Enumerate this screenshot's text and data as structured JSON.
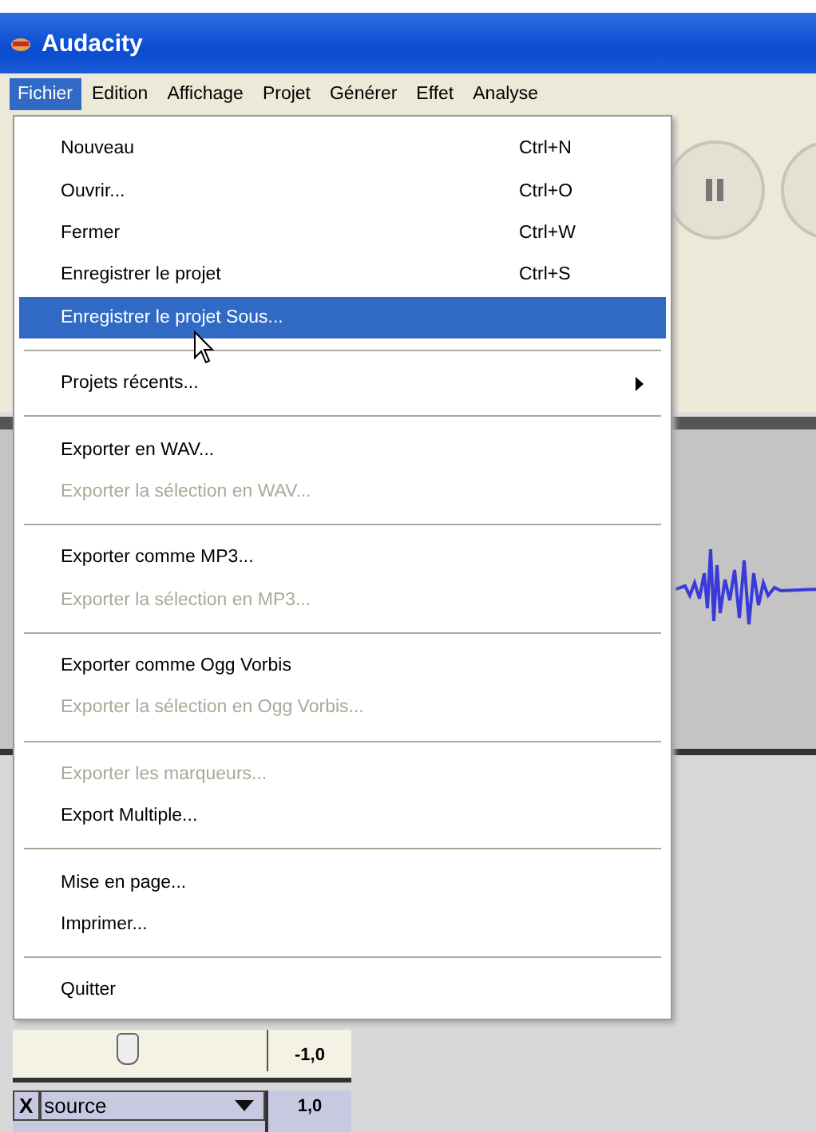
{
  "window": {
    "title": "Audacity"
  },
  "menubar": [
    {
      "label": "Fichier",
      "selected": true
    },
    {
      "label": "Edition",
      "selected": false
    },
    {
      "label": "Affichage",
      "selected": false
    },
    {
      "label": "Projet",
      "selected": false
    },
    {
      "label": "Générer",
      "selected": false
    },
    {
      "label": "Effet",
      "selected": false
    },
    {
      "label": "Analyse",
      "selected": false
    }
  ],
  "menu": [
    {
      "kind": "item",
      "label": "Nouveau",
      "shortcut": "Ctrl+N",
      "disabled": false,
      "selected": false
    },
    {
      "kind": "item",
      "label": "Ouvrir...",
      "shortcut": "Ctrl+O",
      "disabled": false,
      "selected": false
    },
    {
      "kind": "item",
      "label": "Fermer",
      "shortcut": "Ctrl+W",
      "disabled": false,
      "selected": false
    },
    {
      "kind": "item",
      "label": "Enregistrer le projet",
      "shortcut": "Ctrl+S",
      "disabled": false,
      "selected": false
    },
    {
      "kind": "item",
      "label": "Enregistrer le projet Sous...",
      "disabled": false,
      "selected": true
    },
    {
      "kind": "separator"
    },
    {
      "kind": "submenu",
      "label": "Projets récents...",
      "disabled": false,
      "selected": false
    },
    {
      "kind": "separator"
    },
    {
      "kind": "item",
      "label": "Exporter en WAV...",
      "disabled": false,
      "selected": false
    },
    {
      "kind": "item",
      "label": "Exporter la sélection en WAV...",
      "disabled": true,
      "selected": false
    },
    {
      "kind": "separator"
    },
    {
      "kind": "item",
      "label": "Exporter comme MP3...",
      "disabled": false,
      "selected": false
    },
    {
      "kind": "item",
      "label": "Exporter la sélection en MP3...",
      "disabled": true,
      "selected": false
    },
    {
      "kind": "separator"
    },
    {
      "kind": "item",
      "label": "Exporter comme Ogg Vorbis",
      "disabled": false,
      "selected": false
    },
    {
      "kind": "item",
      "label": "Exporter la sélection en Ogg Vorbis...",
      "disabled": true,
      "selected": false
    },
    {
      "kind": "separator"
    },
    {
      "kind": "item",
      "label": "Exporter les marqueurs...",
      "disabled": true,
      "selected": false
    },
    {
      "kind": "item",
      "label": "Export Multiple...",
      "disabled": false,
      "selected": false
    },
    {
      "kind": "separator"
    },
    {
      "kind": "item",
      "label": "Mise en page...",
      "disabled": false,
      "selected": false
    },
    {
      "kind": "item",
      "label": "Imprimer...",
      "disabled": false,
      "selected": false
    },
    {
      "kind": "separator"
    },
    {
      "kind": "item",
      "label": "Quitter",
      "disabled": false,
      "selected": false
    }
  ],
  "track_panel": {
    "gain_slider": {
      "level": 0.45
    },
    "scale_low": "-1,0",
    "close_label": "X",
    "track_name": "source",
    "scale_high": "1,0"
  }
}
